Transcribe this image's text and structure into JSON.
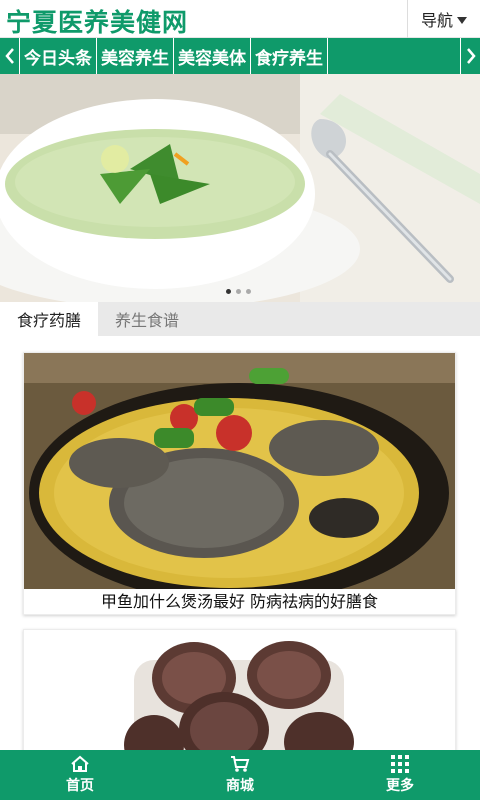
{
  "header": {
    "title": "宁夏医养美健网",
    "nav_label": "导航"
  },
  "categories": [
    "今日头条",
    "美容养生",
    "美容美体",
    "食疗养生"
  ],
  "banner": {
    "slide_count": 3,
    "active_slide": 1
  },
  "tabs": [
    {
      "label": "食疗药膳",
      "active": true
    },
    {
      "label": "养生食谱",
      "active": false
    }
  ],
  "articles": [
    {
      "title": "甲鱼加什么煲汤最好 防病祛病的好膳食"
    }
  ],
  "bottom_nav": [
    {
      "label": "首页",
      "icon": "home-icon"
    },
    {
      "label": "商城",
      "icon": "cart-icon"
    },
    {
      "label": "更多",
      "icon": "grid-icon"
    }
  ],
  "colors": {
    "brand": "#0f9a6a"
  }
}
